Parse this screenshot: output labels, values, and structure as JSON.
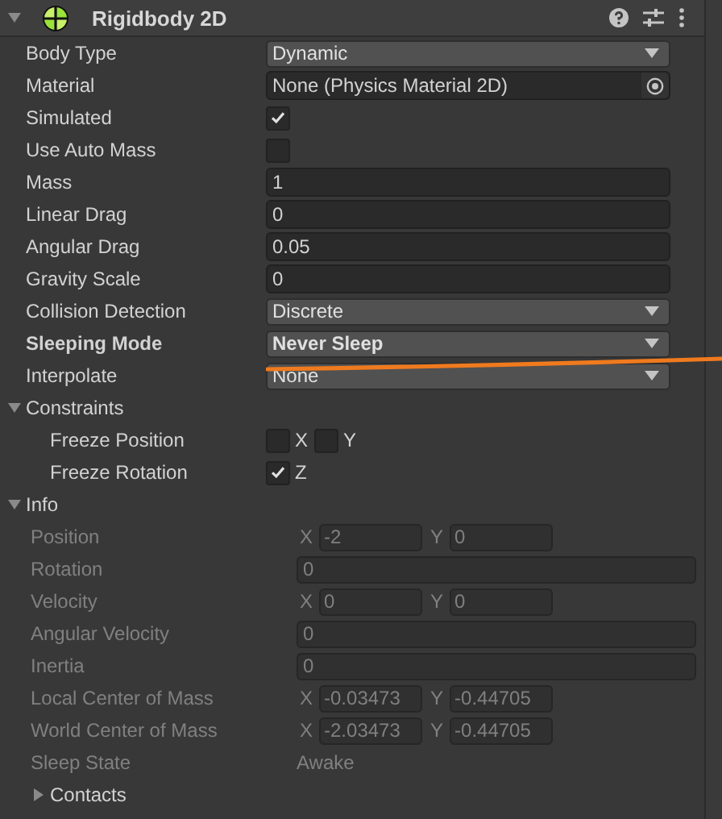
{
  "header": {
    "title": "Rigidbody 2D",
    "expanded": true
  },
  "fields": [
    {
      "kind": "dropdown",
      "label": "Body Type",
      "value": "Dynamic",
      "modified": false
    },
    {
      "kind": "object",
      "label": "Material",
      "value": "None (Physics Material 2D)",
      "modified": false
    },
    {
      "kind": "checkbox",
      "label": "Simulated",
      "checked": true,
      "modified": false
    },
    {
      "kind": "checkbox",
      "label": "Use Auto Mass",
      "checked": false,
      "modified": false
    },
    {
      "kind": "number",
      "label": "Mass",
      "value": "1",
      "modified": false
    },
    {
      "kind": "number",
      "label": "Linear Drag",
      "value": "0",
      "modified": false
    },
    {
      "kind": "number",
      "label": "Angular Drag",
      "value": "0.05",
      "modified": false
    },
    {
      "kind": "number",
      "label": "Gravity Scale",
      "value": "0",
      "modified": false
    },
    {
      "kind": "dropdown",
      "label": "Collision Detection",
      "value": "Discrete",
      "modified": false
    },
    {
      "kind": "dropdown",
      "label": "Sleeping Mode",
      "value": "Never Sleep",
      "modified": true
    },
    {
      "kind": "dropdown",
      "label": "Interpolate",
      "value": "None",
      "modified": false
    }
  ],
  "constraints": {
    "label": "Constraints",
    "expanded": true,
    "children": [
      {
        "label": "Freeze Position",
        "toggles": [
          {
            "axis": "X",
            "checked": false
          },
          {
            "axis": "Y",
            "checked": false
          }
        ]
      },
      {
        "label": "Freeze Rotation",
        "toggles": [
          {
            "axis": "Z",
            "checked": true
          }
        ]
      }
    ]
  },
  "info": {
    "label": "Info",
    "expanded": true,
    "disabled": true,
    "children": [
      {
        "kind": "vector",
        "label": "Position",
        "x": {
          "axis": "X",
          "value": "-2"
        },
        "y": {
          "axis": "Y",
          "value": "0"
        }
      },
      {
        "kind": "number",
        "label": "Rotation",
        "value": "0"
      },
      {
        "kind": "vector",
        "label": "Velocity",
        "x": {
          "axis": "X",
          "value": "0"
        },
        "y": {
          "axis": "Y",
          "value": "0"
        }
      },
      {
        "kind": "number",
        "label": "Angular Velocity",
        "value": "0"
      },
      {
        "kind": "number",
        "label": "Inertia",
        "value": "0"
      },
      {
        "kind": "vector",
        "label": "Local Center of Mass",
        "x": {
          "axis": "X",
          "value": "-0.03473"
        },
        "y": {
          "axis": "Y",
          "value": "-0.44705"
        }
      },
      {
        "kind": "vector",
        "label": "World Center of Mass",
        "x": {
          "axis": "X",
          "value": "-2.03473"
        },
        "y": {
          "axis": "Y",
          "value": "-0.44705"
        }
      },
      {
        "kind": "text",
        "label": "Sleep State",
        "value": "Awake"
      },
      {
        "kind": "foldout",
        "label": "Contacts",
        "expanded": false
      }
    ]
  },
  "annotation": {
    "kind": "underline"
  }
}
